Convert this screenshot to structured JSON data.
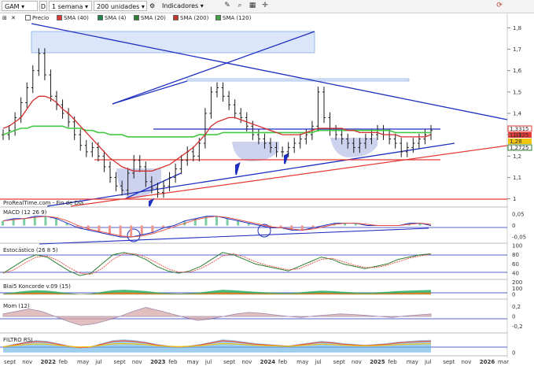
{
  "toolbar": {
    "symbol": "GAM",
    "flag": "D",
    "period": "1 semana",
    "units": "200 unidades",
    "indicators": "Indicadores"
  },
  "legend": {
    "items": [
      {
        "label": "Precio",
        "color": "#ffffff"
      },
      {
        "label": "SMA (40)",
        "color": "#e53935"
      },
      {
        "label": "SMA (4)",
        "color": "#1e8449"
      },
      {
        "label": "SMA (20)",
        "color": "#2e7d32"
      },
      {
        "label": "SMA (200)",
        "color": "#c0392b"
      },
      {
        "label": "SMA (120)",
        "color": "#43a047"
      }
    ]
  },
  "panels": {
    "source": "ProRealTime.com - Fin de Día",
    "macd": "MACD (12 26 9)",
    "stoch": "Estocástico (26 8 5)",
    "koncorde": "Blai5 Koncorde v.09 (15)",
    "mom": "Mom (12)",
    "rsi": "FILTRO RSI"
  },
  "colors": {
    "price_bar": "#1a1a1a",
    "sma40": "#d32f2f",
    "sma20": "#2e7d32",
    "sma120": "#43c943",
    "trendline": "#1f2fbf",
    "support": "#e53935",
    "highlight_box": "#dbe6fb"
  },
  "chart_data": {
    "type": "line",
    "x_labels": [
      "sept",
      "nov",
      "2022",
      "feb",
      "may",
      "jul",
      "sept",
      "nov",
      "2023",
      "feb",
      "may",
      "jul",
      "sept",
      "nov",
      "2024",
      "feb",
      "may",
      "jul",
      "sept",
      "nov",
      "2025",
      "feb",
      "may",
      "jul",
      "sept",
      "nov",
      "2026",
      "mar"
    ],
    "price_axis": {
      "ticks": [
        "1,8",
        "1,7",
        "1,6",
        "1,5",
        "1,4",
        "1,3",
        "1,2",
        "1,1",
        "1"
      ],
      "ylim": [
        0.98,
        1.82
      ],
      "last_labels": [
        "1,3315",
        "1,3225",
        "1,28",
        "1,2725"
      ]
    },
    "price_weekly_close": [
      1.3,
      1.32,
      1.38,
      1.45,
      1.52,
      1.6,
      1.68,
      1.58,
      1.48,
      1.44,
      1.4,
      1.36,
      1.3,
      1.25,
      1.22,
      1.24,
      1.2,
      1.15,
      1.1,
      1.06,
      1.04,
      1.12,
      1.18,
      1.15,
      1.08,
      1.05,
      1.03,
      1.06,
      1.1,
      1.14,
      1.18,
      1.22,
      1.2,
      1.26,
      1.4,
      1.5,
      1.52,
      1.48,
      1.44,
      1.4,
      1.38,
      1.34,
      1.3,
      1.28,
      1.26,
      1.24,
      1.22,
      1.22,
      1.24,
      1.26,
      1.28,
      1.3,
      1.34,
      1.5,
      1.38,
      1.32,
      1.3,
      1.28,
      1.26,
      1.24,
      1.26,
      1.28,
      1.3,
      1.32,
      1.3,
      1.28,
      1.26,
      1.22,
      1.24,
      1.26,
      1.28,
      1.3,
      1.32
    ],
    "sma40": [
      1.33,
      1.34,
      1.36,
      1.38,
      1.42,
      1.46,
      1.48,
      1.48,
      1.47,
      1.45,
      1.42,
      1.4,
      1.37,
      1.34,
      1.31,
      1.28,
      1.25,
      1.22,
      1.19,
      1.17,
      1.15,
      1.14,
      1.13,
      1.13,
      1.13,
      1.13,
      1.14,
      1.15,
      1.16,
      1.18,
      1.2,
      1.22,
      1.24,
      1.27,
      1.3,
      1.34,
      1.36,
      1.37,
      1.38,
      1.38,
      1.37,
      1.36,
      1.35,
      1.34,
      1.33,
      1.32,
      1.31,
      1.3,
      1.3,
      1.3,
      1.3,
      1.31,
      1.32,
      1.33,
      1.33,
      1.33,
      1.33,
      1.33,
      1.32,
      1.32,
      1.31,
      1.31,
      1.31,
      1.31,
      1.3,
      1.3,
      1.3,
      1.29,
      1.29,
      1.29,
      1.29,
      1.29,
      1.3
    ],
    "sma120": [
      1.3,
      1.31,
      1.32,
      1.33,
      1.33,
      1.34,
      1.34,
      1.34,
      1.34,
      1.34,
      1.34,
      1.33,
      1.33,
      1.33,
      1.32,
      1.32,
      1.31,
      1.31,
      1.3,
      1.3,
      1.3,
      1.29,
      1.29,
      1.29,
      1.29,
      1.29,
      1.29,
      1.29,
      1.29,
      1.29,
      1.29,
      1.29,
      1.29,
      1.3,
      1.3,
      1.3,
      1.3,
      1.31,
      1.31,
      1.31,
      1.31,
      1.31,
      1.31,
      1.31,
      1.31,
      1.31,
      1.31,
      1.31,
      1.31,
      1.31,
      1.31,
      1.31,
      1.31,
      1.32,
      1.32,
      1.32,
      1.32,
      1.32,
      1.32,
      1.32,
      1.32,
      1.32,
      1.32,
      1.32,
      1.32,
      1.32,
      1.31,
      1.31,
      1.31,
      1.31,
      1.31,
      1.31,
      1.31
    ],
    "macd_axis": {
      "ticks": [
        "0,05",
        "0",
        "-0,05"
      ],
      "ylim": [
        -0.07,
        0.07
      ]
    },
    "macd_values": [
      0.02,
      0.03,
      0.03,
      0.04,
      0.04,
      0.03,
      0.01,
      -0.01,
      -0.02,
      -0.03,
      -0.04,
      -0.05,
      -0.05,
      -0.04,
      -0.03,
      -0.01,
      0.0,
      0.02,
      0.03,
      0.04,
      0.04,
      0.03,
      0.02,
      0.01,
      0.0,
      -0.01,
      -0.01,
      -0.02,
      -0.02,
      -0.01,
      0.0,
      0.01,
      0.01,
      0.01,
      0.0,
      0.0,
      0.0,
      0.0,
      0.01,
      0.01,
      0.0
    ],
    "stoch_axis": {
      "ticks": [
        "100",
        "80",
        "60",
        "40"
      ],
      "ylim": [
        30,
        100
      ]
    },
    "stoch_values": [
      40,
      55,
      70,
      80,
      75,
      60,
      45,
      35,
      40,
      60,
      80,
      85,
      80,
      70,
      55,
      45,
      40,
      45,
      55,
      70,
      85,
      80,
      70,
      60,
      55,
      50,
      45,
      55,
      65,
      75,
      70,
      60,
      55,
      50,
      55,
      60,
      70,
      75,
      80,
      82
    ],
    "koncorde_axis": {
      "ticks": [
        "200",
        "100",
        "0"
      ],
      "ylim": [
        -50,
        220
      ]
    },
    "mom_axis": {
      "ticks": [
        "0,2",
        "0",
        "-0,2"
      ],
      "ylim": [
        -0.3,
        0.3
      ]
    },
    "mom_values": [
      0.05,
      0.1,
      0.15,
      0.1,
      0.0,
      -0.1,
      -0.18,
      -0.15,
      -0.08,
      0.0,
      0.1,
      0.18,
      0.12,
      0.05,
      -0.02,
      -0.08,
      -0.05,
      0.0,
      0.05,
      0.08,
      0.06,
      0.03,
      0.0,
      -0.02,
      0.01,
      0.03,
      0.05,
      0.04,
      0.02,
      0.0,
      -0.02,
      0.01,
      0.03,
      0.05
    ],
    "rsi_axis": {
      "ticks": [
        "0"
      ],
      "ylim": [
        -10,
        100
      ]
    }
  }
}
